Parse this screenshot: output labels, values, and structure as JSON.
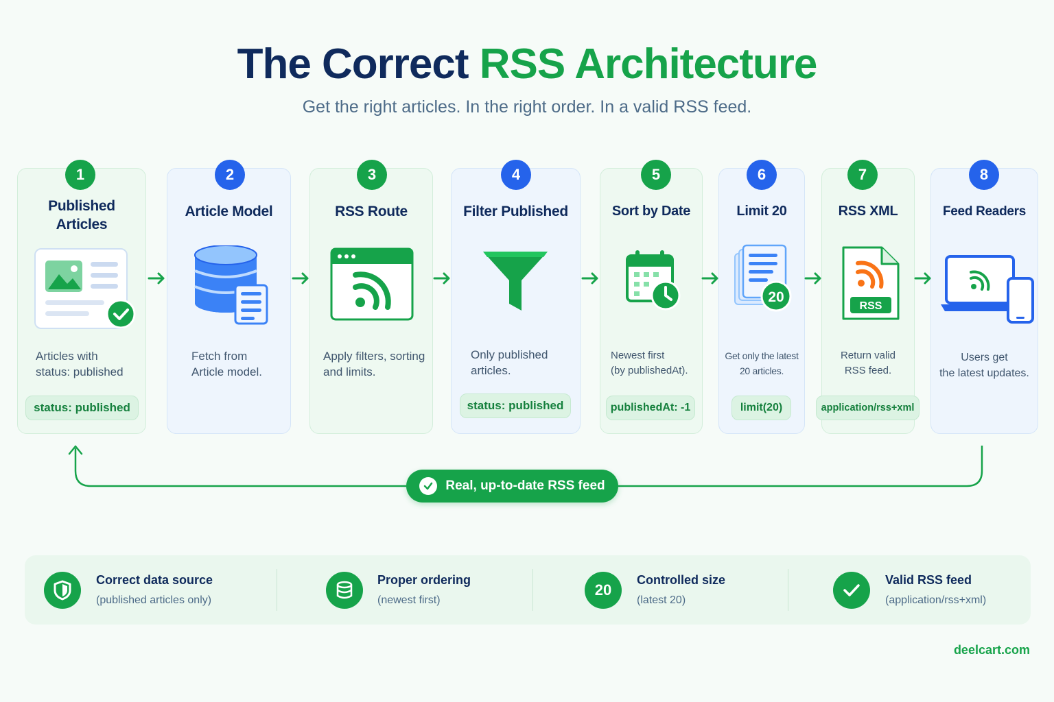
{
  "header": {
    "title_dark": "The Correct",
    "title_green": "RSS Architecture",
    "subtitle": "Get the right articles. In the right order. In a valid RSS feed."
  },
  "steps": [
    {
      "number": "1",
      "title_line1": "Published",
      "title_line2": "Articles",
      "desc_line1": "Articles with",
      "desc_line2": "status: published",
      "pill": "status: published",
      "icon": "article-published-icon",
      "tone": "green"
    },
    {
      "number": "2",
      "title_line1": "Article Model",
      "title_line2": "",
      "desc_line1": "Fetch from",
      "desc_line2": "Article model.",
      "pill": "",
      "icon": "database-icon",
      "tone": "blue"
    },
    {
      "number": "3",
      "title_line1": "RSS Route",
      "title_line2": "",
      "desc_line1": "Apply filters, sorting",
      "desc_line2": "and limits.",
      "pill": "",
      "icon": "browser-rss-icon",
      "tone": "green"
    },
    {
      "number": "4",
      "title_line1": "Filter Published",
      "title_line2": "",
      "desc_line1": "Only published",
      "desc_line2": "articles.",
      "pill": "status: published",
      "icon": "funnel-icon",
      "tone": "blue"
    },
    {
      "number": "5",
      "title_line1": "Sort by Date",
      "title_line2": "",
      "desc_line1": "Newest first",
      "desc_line2": "(by publishedAt).",
      "pill": "publishedAt: -1",
      "icon": "calendar-clock-icon",
      "tone": "green"
    },
    {
      "number": "6",
      "title_line1": "Limit 20",
      "title_line2": "",
      "desc_line1": "Get only the latest",
      "desc_line2": "20 articles.",
      "pill": "limit(20)",
      "icon": "stack-limit-icon",
      "icon_text": "20",
      "tone": "blue"
    },
    {
      "number": "7",
      "title_line1": "RSS XML",
      "title_line2": "",
      "desc_line1": "Return valid",
      "desc_line2": "RSS feed.",
      "pill": "application/rss+xml",
      "icon": "rss-file-icon",
      "icon_text": "RSS",
      "tone": "green"
    },
    {
      "number": "8",
      "title_line1": "Feed Readers",
      "title_line2": "",
      "desc_line1": "Users get",
      "desc_line2": "the latest updates.",
      "pill": "",
      "icon": "devices-icon",
      "tone": "blue"
    }
  ],
  "loop": {
    "label": "Real, up-to-date RSS feed",
    "icon": "check-circle-icon"
  },
  "benefits": [
    {
      "title": "Correct data source",
      "sub": "(published articles only)",
      "icon": "shield-icon"
    },
    {
      "title": "Proper ordering",
      "sub": "(newest first)",
      "icon": "database-icon"
    },
    {
      "title": "Controlled size",
      "sub": "(latest 20)",
      "icon": "number-badge-icon",
      "icon_text": "20"
    },
    {
      "title": "Valid RSS feed",
      "sub": "(application/rss+xml)",
      "icon": "check-icon"
    }
  ],
  "footer": {
    "brand": "deelcart.com"
  },
  "colors": {
    "navy": "#0f2a5c",
    "green": "#16a34a",
    "blue": "#2563eb",
    "rss_orange": "#f97316",
    "background": "#f6fbf8"
  }
}
